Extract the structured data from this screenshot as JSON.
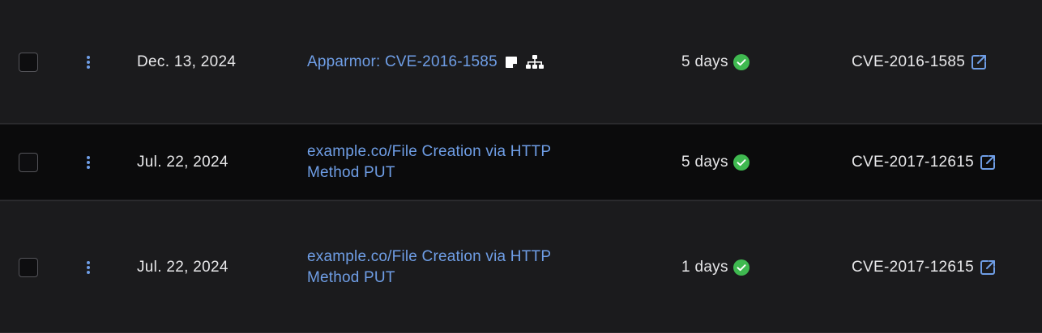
{
  "rows": [
    {
      "date": "Dec. 13, 2024",
      "title_line1": "Apparmor: CVE-2016-1585",
      "title_line2": "",
      "has_note_icon": true,
      "has_tree_icon": true,
      "duration": "5 days",
      "cve": "CVE-2016-1585"
    },
    {
      "date": "Jul. 22, 2024",
      "title_line1": "example.co/File Creation via HTTP",
      "title_line2": "Method PUT",
      "has_note_icon": false,
      "has_tree_icon": false,
      "duration": "5 days",
      "cve": "CVE-2017-12615"
    },
    {
      "date": "Jul. 22, 2024",
      "title_line1": "example.co/File Creation via HTTP",
      "title_line2": "Method PUT",
      "has_note_icon": false,
      "has_tree_icon": false,
      "duration": "1 days",
      "cve": "CVE-2017-12615"
    }
  ],
  "colors": {
    "link": "#6f9ee6",
    "success": "#3fb950",
    "text": "#e8e8ea"
  },
  "icons": {
    "row_menu": "kebab-vertical-icon",
    "note": "note-icon",
    "hierarchy": "hierarchy-icon",
    "status": "check-circle-icon",
    "external": "external-link-icon"
  }
}
